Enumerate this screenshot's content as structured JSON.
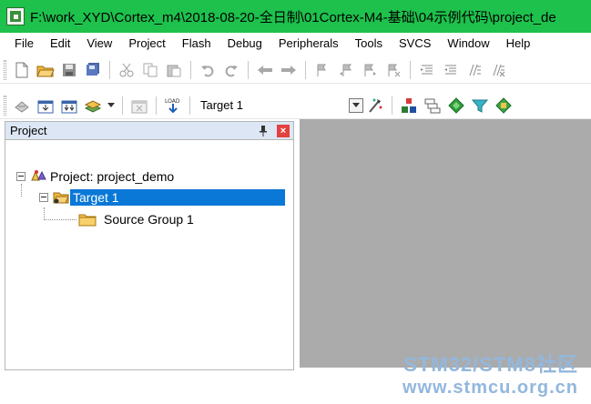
{
  "window": {
    "title": "F:\\work_XYD\\Cortex_m4\\2018-08-20-全日制\\01Cortex-M4-基础\\04示例代码\\project_de"
  },
  "menu": {
    "items": [
      "File",
      "Edit",
      "View",
      "Project",
      "Flash",
      "Debug",
      "Peripherals",
      "Tools",
      "SVCS",
      "Window",
      "Help"
    ]
  },
  "build_toolbar": {
    "target_label": "Target 1"
  },
  "project_panel": {
    "title": "Project",
    "tree": {
      "root": "Project: project_demo",
      "target": "Target 1",
      "group": "Source Group 1"
    }
  },
  "watermark": {
    "line1": "STM32/STM8社区",
    "line2": "www.stmcu.org.cn"
  },
  "colors": {
    "titlebar": "#1dc14c",
    "selection": "#0a78d7",
    "workspace": "#ababab",
    "watermark": "#93b7dd"
  }
}
